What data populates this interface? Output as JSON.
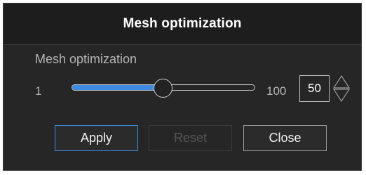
{
  "dialog": {
    "title": "Mesh optimization",
    "group_label": "Mesh optimization",
    "slider": {
      "min_label": "1",
      "max_label": "100",
      "value": 50,
      "min": 1,
      "max": 100
    },
    "spinbox": {
      "value": "50"
    },
    "buttons": {
      "apply": "Apply",
      "reset": "Reset",
      "close": "Close"
    }
  },
  "colors": {
    "accent": "#3e8ae0",
    "background": "#262626",
    "titlebar": "#1d1d1d",
    "text": "#ffffff",
    "muted_text": "#b5b5b5",
    "disabled_text": "#555555"
  },
  "icons": {
    "spin_up": "triangle-up-icon",
    "spin_down": "triangle-down-icon"
  }
}
